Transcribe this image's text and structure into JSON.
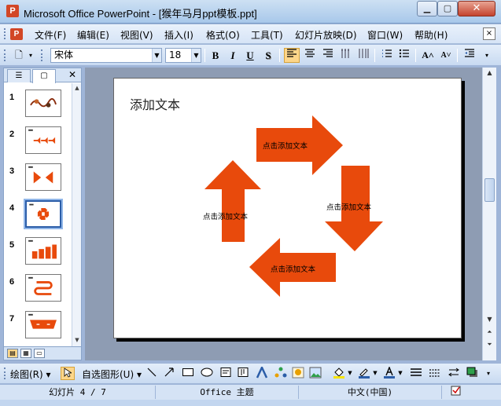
{
  "window": {
    "title": "Microsoft Office PowerPoint - [猴年马月ppt模板.ppt]",
    "app_icon": "P",
    "min_glyph": "▁",
    "max_glyph": "▢",
    "close_glyph": "✕"
  },
  "menu": {
    "items": [
      "文件(F)",
      "编辑(E)",
      "视图(V)",
      "插入(I)",
      "格式(O)",
      "工具(T)",
      "幻灯片放映(D)",
      "窗口(W)",
      "帮助(H)"
    ]
  },
  "toolbar": {
    "font_name": "宋体",
    "font_size": "18",
    "bold": "B",
    "italic": "I",
    "underline": "U",
    "shadow": "S",
    "grow_font": "A˄",
    "shrink_font": "A˅"
  },
  "left_pane": {
    "tab_outline_glyph": "☰",
    "tab_slides_glyph": "▢",
    "close_glyph": "✕",
    "slide_numbers": [
      "1",
      "2",
      "3",
      "4",
      "5",
      "6",
      "7"
    ],
    "selected_slide": 4
  },
  "slide": {
    "title": "添加文本",
    "arrow_labels": {
      "top": "点击添加文本",
      "right": "点击添加文本",
      "bottom": "点击添加文本",
      "left": "点击添加文本"
    },
    "arrow_color": "#e84a0c"
  },
  "drawbar": {
    "draw_label": "绘图(R)",
    "autoshape_label": "自选图形(U)"
  },
  "status": {
    "slide_info": "幻灯片 4 / 7",
    "theme": "Office 主题",
    "language": "中文(中国)"
  }
}
